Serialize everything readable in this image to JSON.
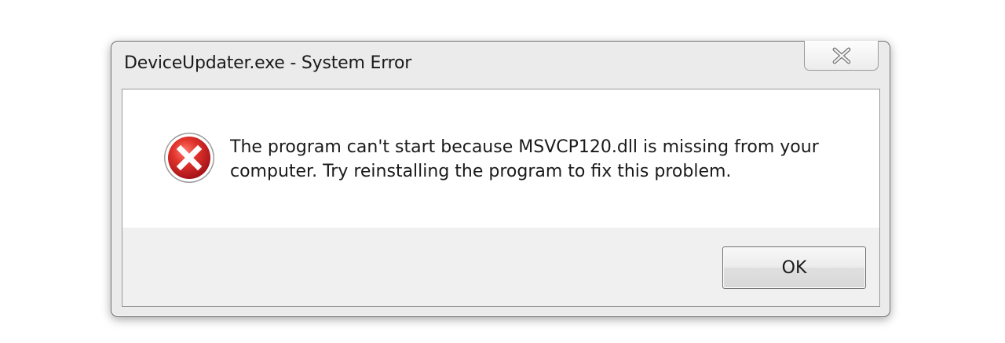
{
  "window": {
    "title": "DeviceUpdater.exe - System Error",
    "close_icon": "close-icon"
  },
  "message": {
    "icon": "error-icon",
    "text": "The program can't start because MSVCP120.dll is missing from your computer. Try reinstalling the program to fix this problem."
  },
  "buttons": {
    "ok_label": "OK"
  },
  "colors": {
    "error_red": "#d42a2a",
    "content_bg": "#ffffff",
    "footer_bg": "#f0f0f0"
  }
}
